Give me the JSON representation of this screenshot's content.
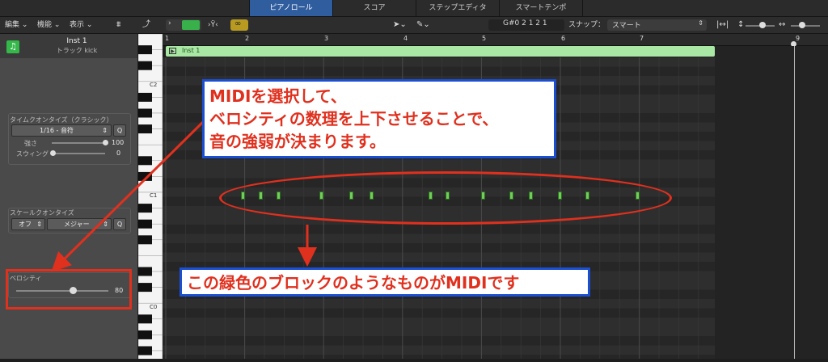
{
  "tabs": [
    {
      "label": "ピアノロール",
      "active": true
    },
    {
      "label": "スコア",
      "active": false
    },
    {
      "label": "ステップエディタ",
      "active": false
    },
    {
      "label": "スマートテンポ",
      "active": false
    }
  ],
  "toolbar": {
    "menu_edit": "編集",
    "menu_function": "機能",
    "menu_view": "表示",
    "position": "G#0  2 1 2 1",
    "snap_label": "スナップ：",
    "snap_value": "スマート"
  },
  "inspector": {
    "track_name": "Inst 1",
    "track_sub": "トラック kick",
    "time_quantize_label": "タイムクオンタイズ（クラシック）",
    "time_quantize_value": "1/16 - 音符",
    "q_button": "Q",
    "strength_label": "強さ",
    "strength_value": "100",
    "strength_level": 1.0,
    "swing_label": "スウィング",
    "swing_value": "0",
    "swing_level": 0.0,
    "scale_quantize_label": "スケールクオンタイズ",
    "scale_off": "オフ",
    "scale_mode": "メジャー",
    "velocity_label": "ベロシティ",
    "velocity_value": "80",
    "velocity_level": 0.63
  },
  "keyboard": {
    "labels": [
      "C2",
      "C1",
      "C0"
    ]
  },
  "ruler": {
    "bars": [
      "1",
      "2",
      "3",
      "4",
      "5",
      "6",
      "7",
      "9"
    ]
  },
  "region": {
    "name": "Inst 1"
  },
  "notes_bar_positions": [
    1.95,
    2.18,
    2.4,
    2.95,
    3.33,
    3.58,
    4.33,
    4.55,
    5.0,
    5.35,
    5.6,
    5.97,
    6.32,
    6.95
  ],
  "annotations": {
    "top_line1": "MIDIを選択して、",
    "top_line2": "ベロシティの数理を上下させることで、",
    "top_line3": "音の強弱が決まります。",
    "bottom": "この緑色のブロックのようなものがMIDIです"
  },
  "colors": {
    "accent": "#2f5d9e",
    "note": "#6fcf57",
    "annotation_red": "#e0301e",
    "callout_border": "#1b4fd1"
  }
}
